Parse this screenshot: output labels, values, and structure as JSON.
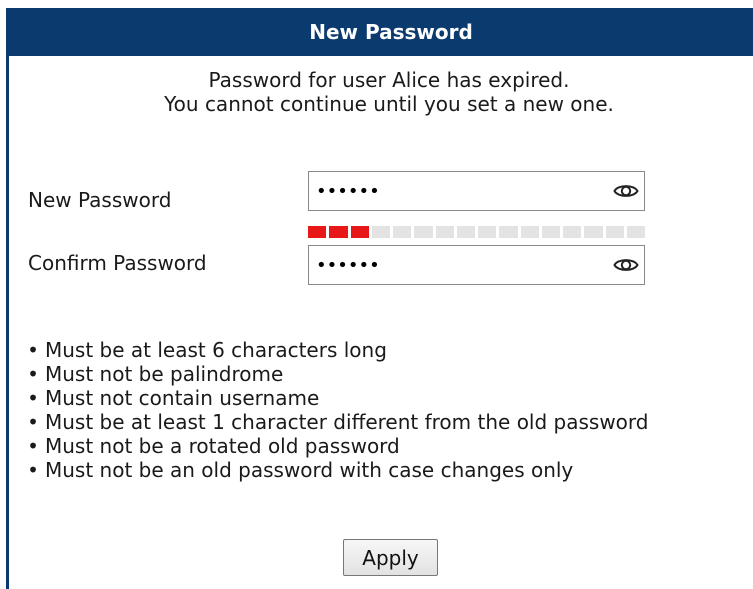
{
  "dialog": {
    "title": "New Password",
    "message_line1": "Password for user Alice has expired.",
    "message_line2": "You cannot continue until you set a new one."
  },
  "form": {
    "new_password_label": "New Password",
    "new_password_value": "••••••",
    "confirm_password_label": "Confirm Password",
    "confirm_password_value": "••••••",
    "show_password_icon": "eye-icon",
    "strength_meter": {
      "filled_segments": 3,
      "total_segments": 16,
      "filled_color": "#e81818",
      "empty_color": "#e3e3e3"
    }
  },
  "requirements": [
    "Must be at least 6 characters long",
    "Must not be palindrome",
    "Must not contain username",
    "Must be at least 1 character different from the old password",
    "Must not be a rotated old password",
    "Must not be an old password with case changes only"
  ],
  "actions": {
    "apply_label": "Apply"
  },
  "colors": {
    "titlebar_bg": "#0b3a6e",
    "titlebar_text": "#ffffff"
  }
}
